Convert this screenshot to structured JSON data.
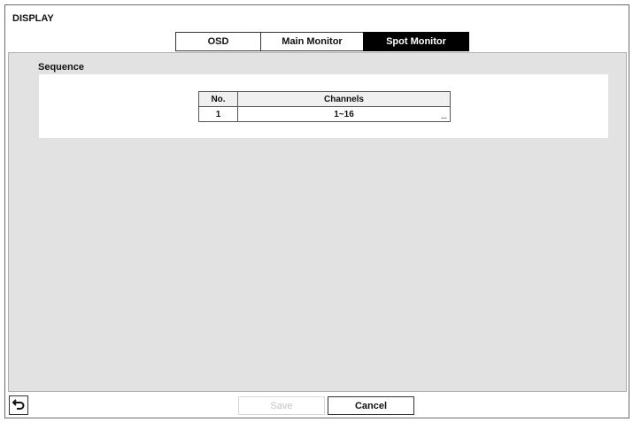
{
  "window": {
    "title": "DISPLAY"
  },
  "tabs": [
    {
      "label": "OSD",
      "active": false
    },
    {
      "label": "Main Monitor",
      "active": false
    },
    {
      "label": "Spot Monitor",
      "active": true
    }
  ],
  "section": {
    "label": "Sequence",
    "table": {
      "headers": [
        "No.",
        "Channels"
      ],
      "rows": [
        {
          "no": "1",
          "channels": "1~16"
        }
      ]
    }
  },
  "footer": {
    "back_icon": "undo-arrow-icon",
    "save_label": "Save",
    "cancel_label": "Cancel"
  },
  "colors": {
    "active_tab_bg": "#000000",
    "panel_bg": "#e2e2e2",
    "disabled_text": "#c4c4c4"
  }
}
